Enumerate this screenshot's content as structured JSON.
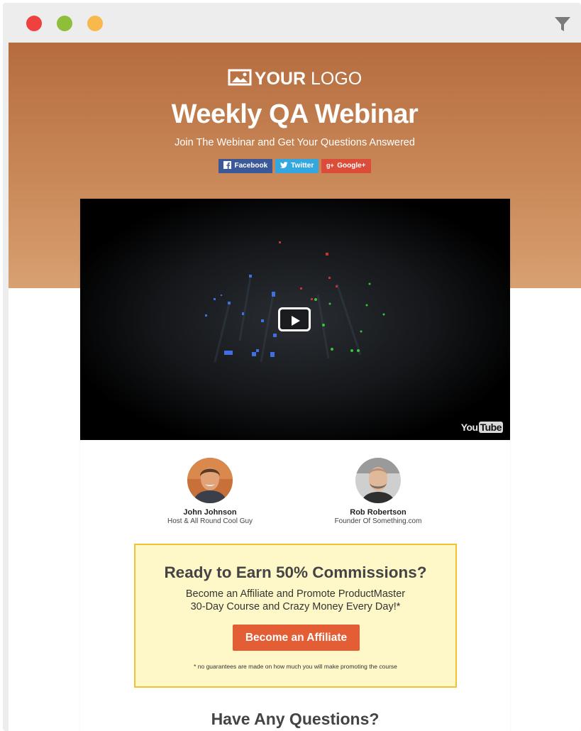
{
  "window": {
    "controls": [
      "close",
      "minimize",
      "maximize"
    ],
    "filter_icon": "filter-icon"
  },
  "header": {
    "logo_bold": "YOUR",
    "logo_light": "LOGO",
    "title": "Weekly QA Webinar",
    "subtitle": "Join The Webinar and Get Your Questions Answered"
  },
  "social": [
    {
      "label": "Facebook",
      "icon": "facebook-icon",
      "color": "#3b5998"
    },
    {
      "label": "Twitter",
      "icon": "twitter-icon",
      "color": "#33a8e0"
    },
    {
      "label": "Google+",
      "icon": "google-plus-icon",
      "color": "#dd4b39"
    }
  ],
  "video": {
    "watermark_you": "You",
    "watermark_tube": "Tube",
    "play_icon": "play-icon"
  },
  "hosts": [
    {
      "name": "John Johnson",
      "role": "Host & All Round Cool Guy"
    },
    {
      "name": "Rob Robertson",
      "role": "Founder Of Something.com"
    }
  ],
  "affiliate": {
    "title": "Ready to Earn 50% Commissions?",
    "body_line1": "Become an Affiliate and Promote ProductMaster",
    "body_line2": "30-Day Course and Crazy Money Every Day!*",
    "button": "Become an Affiliate",
    "note": "* no guarantees are made on how much you will make promoting the course"
  },
  "questions": {
    "title": "Have Any Questions?"
  },
  "colors": {
    "hero_top": "#b56c3e",
    "hero_bottom": "#d8a071",
    "affiliate_bg": "#fef8c9",
    "affiliate_border": "#f1c232",
    "cta": "#e35d35"
  }
}
